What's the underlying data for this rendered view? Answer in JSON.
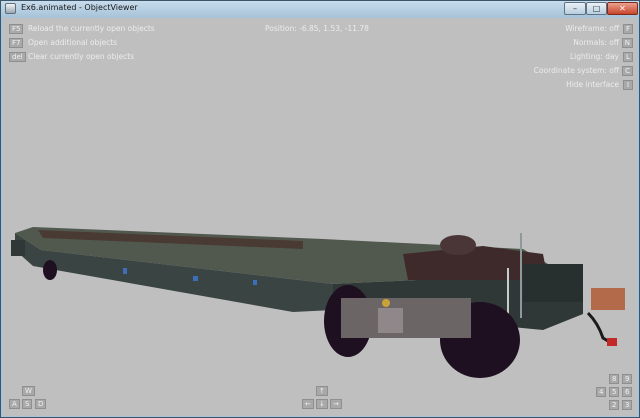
{
  "window": {
    "title": "Ex6.animated - ObjectViewer",
    "buttons": {
      "minimize": "–",
      "maximize": "□",
      "close": "✕"
    }
  },
  "hud": {
    "left_items": [
      {
        "key": "F5",
        "label": "Reload the currently open objects"
      },
      {
        "key": "F7",
        "label": "Open additional objects"
      },
      {
        "key": "del",
        "label": "Clear currently open objects"
      }
    ],
    "position": "Position: -6.85, 1.53, -11.78",
    "right_items": [
      {
        "key": "F",
        "label": "Wireframe: off"
      },
      {
        "key": "N",
        "label": "Normals: off"
      },
      {
        "key": "L",
        "label": "Lighting: day"
      },
      {
        "key": "C",
        "label": "Coordinate system: off"
      },
      {
        "key": "I",
        "label": "Hide interface"
      }
    ],
    "nav_left": {
      "w": "W",
      "a": "A",
      "s": "S",
      "d": "D"
    },
    "nav_center": {
      "up": "↑",
      "left": "←",
      "down": "↓",
      "right": "→"
    },
    "nav_right": {
      "n8": "8",
      "n9": "9",
      "n4": "4",
      "n5": "5",
      "n6": "6",
      "n2": "2",
      "n3": "3"
    }
  },
  "scene": {
    "background": "#bfbfbf",
    "wagon_body": "#3f4a48",
    "wheel_color": "#1e1020"
  }
}
